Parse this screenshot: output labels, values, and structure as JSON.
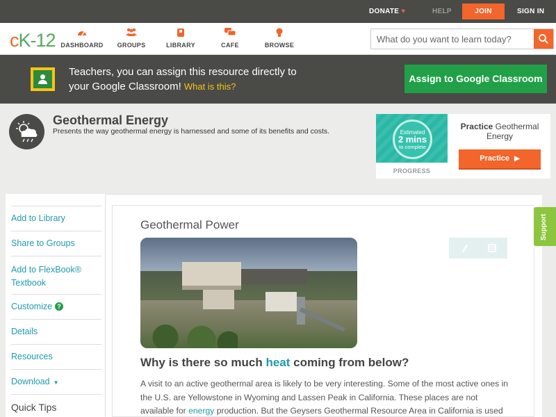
{
  "topbar": {
    "donate": "DONATE",
    "help": "HELP",
    "join": "JOIN",
    "sign_in": "SIGN IN"
  },
  "logo": {
    "text": "CK-12"
  },
  "nav": {
    "dashboard": "DASHBOARD",
    "groups": "GROUPS",
    "library": "LIBRARY",
    "cafe": "CAFE",
    "browse": "BROWSE"
  },
  "search": {
    "placeholder": "What do you want to learn today?"
  },
  "banner": {
    "text": "Teachers, you can assign this resource directly to your Google Classroom!",
    "what_link": "What is this?",
    "assign_button": "Assign to Google Classroom"
  },
  "concept": {
    "title": "Geothermal Energy",
    "description": "Presents the way geothermal energy is harnessed and some of its benefits and costs."
  },
  "practice_card": {
    "estimate_line1": "Estimated",
    "estimate_line2": "2 mins",
    "estimate_line3": "to complete",
    "progress_label": "PROGRESS",
    "title_bold": "Practice",
    "title_rest": "Geothermal Energy",
    "button": "Practice"
  },
  "sidebar": {
    "items": [
      {
        "label": "Add to Library"
      },
      {
        "label": "Share to Groups"
      },
      {
        "label": "Add to FlexBook® Textbook"
      },
      {
        "label": "Customize"
      },
      {
        "label": "Details"
      },
      {
        "label": "Resources"
      },
      {
        "label": "Download"
      },
      {
        "label": "Quick Tips"
      }
    ]
  },
  "content": {
    "section_title": "Geothermal Power",
    "question_prefix": "Why is there so much ",
    "question_highlight": "heat",
    "question_suffix": " coming from below?",
    "para_part1": "A visit to an active geothermal area is likely to be very interesting. Some of the most active ones in the U.S. are Yellowstone in Wyoming and Lassen Peak in California. These places are not available for ",
    "para_link": "energy",
    "para_part2": " production. But the Geysers Geothermal Resource Area in California is used"
  },
  "support_tab": {
    "label": "Support"
  },
  "colors": {
    "brand_orange": "#f2652b",
    "brand_green": "#21a048",
    "link_teal": "#1f9ab0",
    "dark_bar": "#4a4a47"
  }
}
